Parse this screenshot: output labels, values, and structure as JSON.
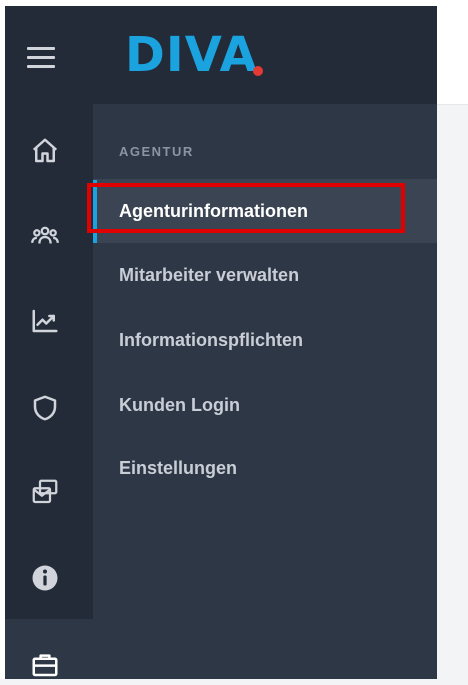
{
  "app": {
    "logo_text": "DIVA",
    "brand_color": "#1ba3e0",
    "logo_dot_color": "#e53935"
  },
  "rail": {
    "icons": [
      {
        "name": "home-icon"
      },
      {
        "name": "users-icon"
      },
      {
        "name": "chart-line-icon"
      },
      {
        "name": "shield-icon"
      },
      {
        "name": "messages-icon"
      },
      {
        "name": "info-icon"
      },
      {
        "name": "briefcase-icon",
        "active": true
      }
    ]
  },
  "submenu": {
    "header": "AGENTUR",
    "items": [
      {
        "label": "Agenturinformationen",
        "active": true
      },
      {
        "label": "Mitarbeiter verwalten"
      },
      {
        "label": "Informationspflichten"
      },
      {
        "label": "Kunden Login"
      },
      {
        "label": "Einstellungen"
      }
    ]
  },
  "annotation": {
    "highlight_color": "#e00000"
  }
}
